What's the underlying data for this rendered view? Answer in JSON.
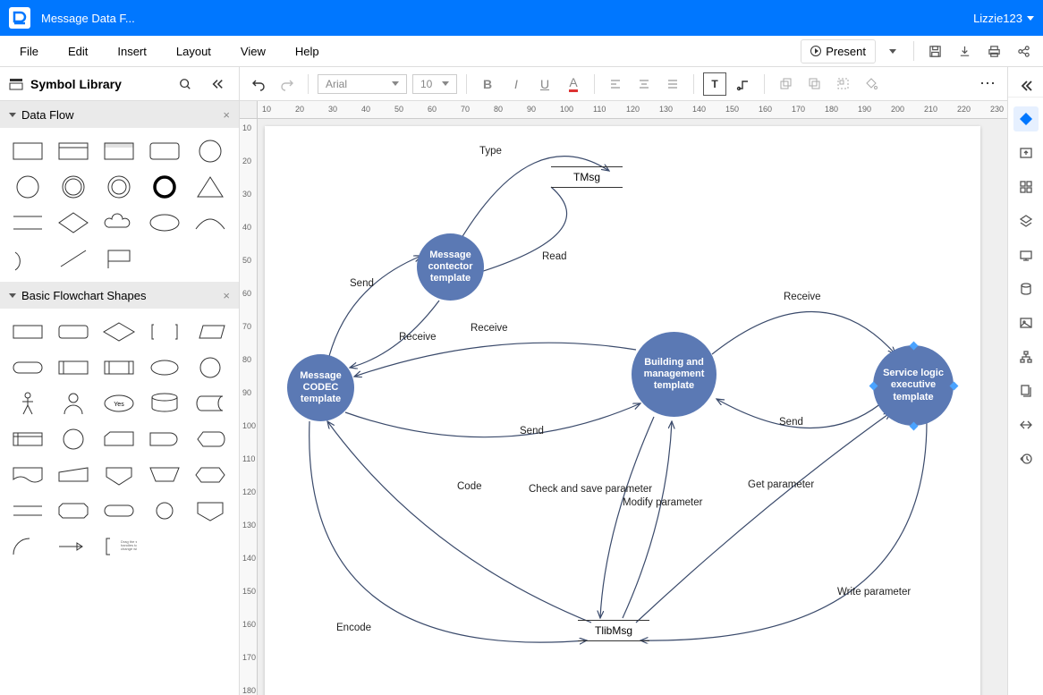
{
  "titlebar": {
    "doc_title": "Message Data F...",
    "user": "Lizzie123"
  },
  "menu": {
    "file": "File",
    "edit": "Edit",
    "insert": "Insert",
    "layout": "Layout",
    "view": "View",
    "help": "Help",
    "present": "Present"
  },
  "sidebar": {
    "library_title": "Symbol Library",
    "sections": {
      "data_flow": "Data Flow",
      "basic_flowchart": "Basic Flowchart Shapes"
    }
  },
  "toolbar": {
    "font": "Arial",
    "font_size": "10"
  },
  "ruler_h": [
    "10",
    "20",
    "30",
    "40",
    "50",
    "60",
    "70",
    "80",
    "90",
    "100",
    "110",
    "120",
    "130",
    "140",
    "150",
    "160",
    "170",
    "180",
    "190",
    "200",
    "210",
    "220",
    "230"
  ],
  "ruler_v": [
    "10",
    "20",
    "30",
    "40",
    "50",
    "60",
    "70",
    "80",
    "90",
    "100",
    "110",
    "120",
    "130",
    "140",
    "150",
    "160",
    "170",
    "180"
  ],
  "diagram": {
    "nodes": {
      "tmsg": "TMsg",
      "msg_contector": "Message contector template",
      "msg_codec": "Message CODEC template",
      "building_mgmt": "Building and management template",
      "service_logic": "Service logic executive template",
      "tlibmsg": "TlibMsg"
    },
    "edges": {
      "type": "Type",
      "read": "Read",
      "send1": "Send",
      "receive1": "Receive",
      "receive2": "Receive",
      "receive3": "Receive",
      "send2": "Send",
      "send3": "Send",
      "code": "Code",
      "check_save": "Check and save parameter",
      "modify_param": "Modify parameter",
      "get_param": "Get parameter",
      "write_param": "Write parameter",
      "encode": "Encode"
    }
  },
  "shapes_basic_decision": "Yes"
}
